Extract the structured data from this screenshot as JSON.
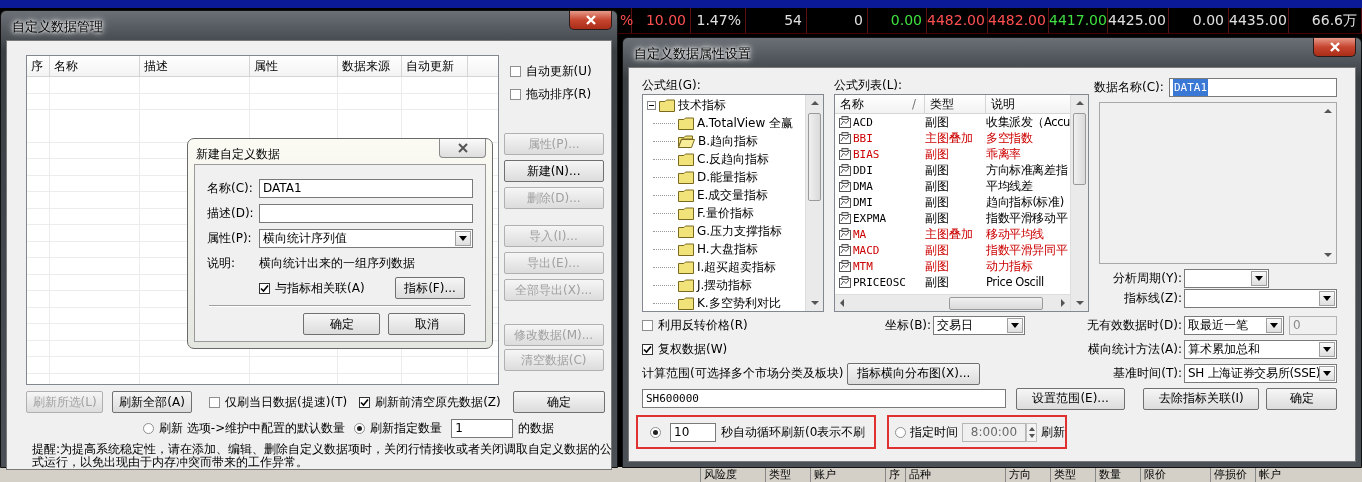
{
  "background": {
    "quotes": [
      {
        "text": "%",
        "color": "#ff5050"
      },
      {
        "text": "10.00",
        "color": "#ff5050"
      },
      {
        "text": "1.47%",
        "color": "#e0e0e0"
      },
      {
        "text": "54",
        "color": "#e0e0e0"
      },
      {
        "text": "0",
        "color": "#e0e0e0"
      },
      {
        "text": "0.00",
        "color": "#40e040"
      },
      {
        "text": "4482.00",
        "color": "#ff5050"
      },
      {
        "text": "4482.00",
        "color": "#ff5050"
      },
      {
        "text": "4417.00",
        "color": "#40e040"
      },
      {
        "text": "4425.00",
        "color": "#e0e0e0"
      },
      {
        "text": "0.00",
        "color": "#e0e0e0"
      },
      {
        "text": "4435.00",
        "color": "#e0e0e0"
      },
      {
        "text": "66.6万",
        "color": "#e0e0e0"
      }
    ],
    "bottom_headers": [
      "风险度",
      "类型",
      "账户",
      "序",
      "品种",
      "方向",
      "类型",
      "数量",
      "限价",
      "停损价",
      "帐户"
    ]
  },
  "manager": {
    "title": "自定义数据管理",
    "columns": [
      "序",
      "名称",
      "描述",
      "属性",
      "数据来源",
      "自动更新"
    ],
    "options": [
      {
        "label": "自动更新(U)",
        "checked": false
      },
      {
        "label": "拖动排序(R)",
        "checked": false
      }
    ],
    "button_groups": [
      [
        {
          "label": "属性(P)...",
          "disabled": true
        },
        {
          "label": "新建(N)...",
          "disabled": false
        },
        {
          "label": "删除(D)...",
          "disabled": true
        }
      ],
      [
        {
          "label": "导入(I)...",
          "disabled": true
        },
        {
          "label": "导出(E)...",
          "disabled": true
        },
        {
          "label": "全部导出(X)...",
          "disabled": true
        }
      ],
      [
        {
          "label": "修改数据(M)...",
          "disabled": true
        },
        {
          "label": "清空数据(C)",
          "disabled": true
        }
      ]
    ],
    "refresh_buttons": [
      {
        "label": "刷新所选(L)",
        "disabled": true
      },
      {
        "label": "刷新全部(A)",
        "disabled": false
      }
    ],
    "refresh_options": [
      {
        "label": "仅刷当日数据(提速)(T)",
        "checked": false
      },
      {
        "label": "刷新前清空原先数据(Z)",
        "checked": true
      }
    ],
    "ok": "确定",
    "count_modes": [
      {
        "label": "刷新 选项->维护中配置的默认数量",
        "selected": false
      },
      {
        "label": "刷新指定数量",
        "selected": true
      }
    ],
    "count": "1",
    "count_suffix": "的数据",
    "note": "提醒:为提高系统稳定性，请在添加、编辑、删除自定义数据项时，关闭行情接收或者关闭调取自定义数据的公式运行，以免出现由于内存冲突而带来的工作异常。"
  },
  "new_dialog": {
    "title": "新建自定义数据",
    "fields": [
      {
        "label": "名称(C):",
        "kind": "text",
        "value": "DATA1"
      },
      {
        "label": "描述(D):",
        "kind": "text"
      },
      {
        "label": "属性(P):",
        "kind": "select",
        "value": "横向统计序列值"
      }
    ],
    "description_label": "说明:",
    "description": "横向统计出来的一组序列数据",
    "link": {
      "label": "与指标相关联(A)",
      "checked": true
    },
    "indicator_button": "指标(F)...",
    "buttons": [
      "确定",
      "取消"
    ]
  },
  "settings": {
    "title": "自定义数据属性设置",
    "group_label": "公式组(G):",
    "tree": {
      "label": "技术指标",
      "expanded": true,
      "children": [
        {
          "label": "A.TotalView 全赢",
          "selected": false
        },
        {
          "label": "B.趋向指标",
          "selected": true
        },
        {
          "label": "C.反趋向指标",
          "selected": false
        },
        {
          "label": "D.能量指标",
          "selected": false
        },
        {
          "label": "E.成交量指标",
          "selected": false
        },
        {
          "label": "F.量价指标",
          "selected": false
        },
        {
          "label": "G.压力支撑指标",
          "selected": false
        },
        {
          "label": "H.大盘指标",
          "selected": false
        },
        {
          "label": "I.超买超卖指标",
          "selected": false
        },
        {
          "label": "J.摆动指标",
          "selected": false
        },
        {
          "label": "K.多空势利对比",
          "selected": false
        }
      ]
    },
    "list_label": "公式列表(L):",
    "list_columns": [
      "名称",
      "类型",
      "说明"
    ],
    "sort_mark": "/",
    "formulas": [
      {
        "name": "ACD",
        "type": "副图",
        "description": "收集派发（Accu",
        "color": "#000000"
      },
      {
        "name": "BBI",
        "type": "主图叠加",
        "description": "多空指数",
        "color": "#cc0000"
      },
      {
        "name": "BIAS",
        "type": "副图",
        "description": "乖离率",
        "color": "#cc0000"
      },
      {
        "name": "DDI",
        "type": "副图",
        "description": "方向标准离差指",
        "color": "#000000"
      },
      {
        "name": "DMA",
        "type": "副图",
        "description": "平均线差",
        "color": "#000000"
      },
      {
        "name": "DMI",
        "type": "副图",
        "description": "趋向指标(标准)",
        "color": "#000000"
      },
      {
        "name": "EXPMA",
        "type": "副图",
        "description": "指数平滑移动平",
        "color": "#000000"
      },
      {
        "name": "MA",
        "type": "主图叠加",
        "description": "移动平均线",
        "color": "#cc0000"
      },
      {
        "name": "MACD",
        "type": "副图",
        "description": "指数平滑异同平",
        "color": "#cc0000"
      },
      {
        "name": "MTM",
        "type": "副图",
        "description": "动力指标",
        "color": "#cc0000"
      },
      {
        "name": "PRICEOSC",
        "type": "副图",
        "description": "Price Oscill",
        "color": "#000000"
      }
    ],
    "data_name_label": "数据名称(C):",
    "data_name": "DATA1",
    "period_label": "分析周期(Y):",
    "line_label": "指标线(Z):",
    "reverse_price": {
      "label": "利用反转价格(R)",
      "checked": false
    },
    "adjusted": {
      "label": "复权数据(W)",
      "checked": true
    },
    "axis_label": "坐标(B):",
    "axis": "交易日",
    "no_data_label": "无有效数据时(D):",
    "no_data": "取最近一笔",
    "no_data_value": "0",
    "method_label": "横向统计方法(A):",
    "method": "算术累加总和",
    "range_label": "计算范围(可选择多个市场分类及板块)",
    "distribution_button": "指标横向分布图(X)...",
    "base_time_label": "基准时间(T):",
    "base_time": "SH 上海证券交易所(SSE)",
    "range": "SH600000",
    "buttons": [
      "设置范围(E)...",
      "去除指标关联(I)",
      "确定"
    ],
    "refresh_modes": [
      {
        "kind": "interval",
        "selected": true,
        "value": "10",
        "label": "秒自动循环刷新(0表示不刷"
      },
      {
        "kind": "timed",
        "selected": false,
        "label": "指定时间",
        "value": "8:00:00",
        "suffix": "刷新"
      }
    ]
  }
}
